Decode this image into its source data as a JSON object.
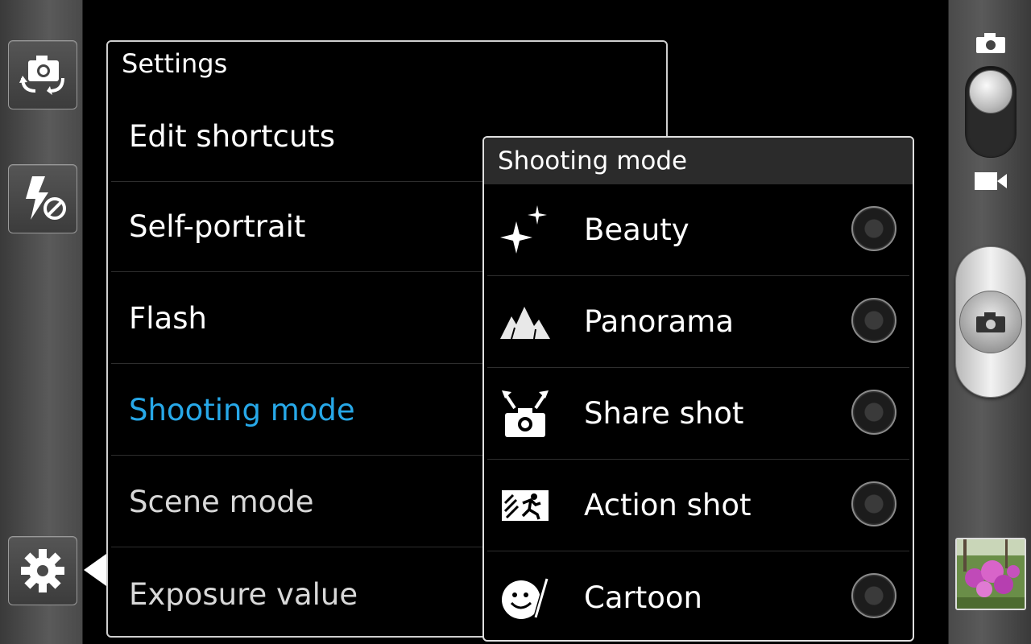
{
  "settings": {
    "title": "Settings",
    "items": [
      {
        "label": "Edit shortcuts",
        "state": "normal"
      },
      {
        "label": "Self-portrait",
        "state": "normal"
      },
      {
        "label": "Flash",
        "state": "normal"
      },
      {
        "label": "Shooting mode",
        "state": "active"
      },
      {
        "label": "Scene mode",
        "state": "dim"
      },
      {
        "label": "Exposure value",
        "state": "dim"
      }
    ]
  },
  "shooting_mode": {
    "title": "Shooting mode",
    "options": [
      {
        "label": "Beauty",
        "icon": "sparkle-icon",
        "selected": false
      },
      {
        "label": "Panorama",
        "icon": "mountains-icon",
        "selected": false
      },
      {
        "label": "Share shot",
        "icon": "share-camera-icon",
        "selected": false
      },
      {
        "label": "Action shot",
        "icon": "running-person-icon",
        "selected": false
      },
      {
        "label": "Cartoon",
        "icon": "cartoon-face-icon",
        "selected": false
      }
    ]
  },
  "left_bar": {
    "buttons": [
      "switch-camera-icon",
      "flash-off-icon",
      "gear-icon"
    ]
  },
  "right_bar": {
    "mode": "camera",
    "icons": [
      "camera-mode-icon",
      "video-mode-icon",
      "shutter-camera-icon"
    ]
  },
  "colors": {
    "accent": "#27a8e8",
    "panel_border": "#cfcfcf",
    "header_bg": "#2b2b2b"
  }
}
